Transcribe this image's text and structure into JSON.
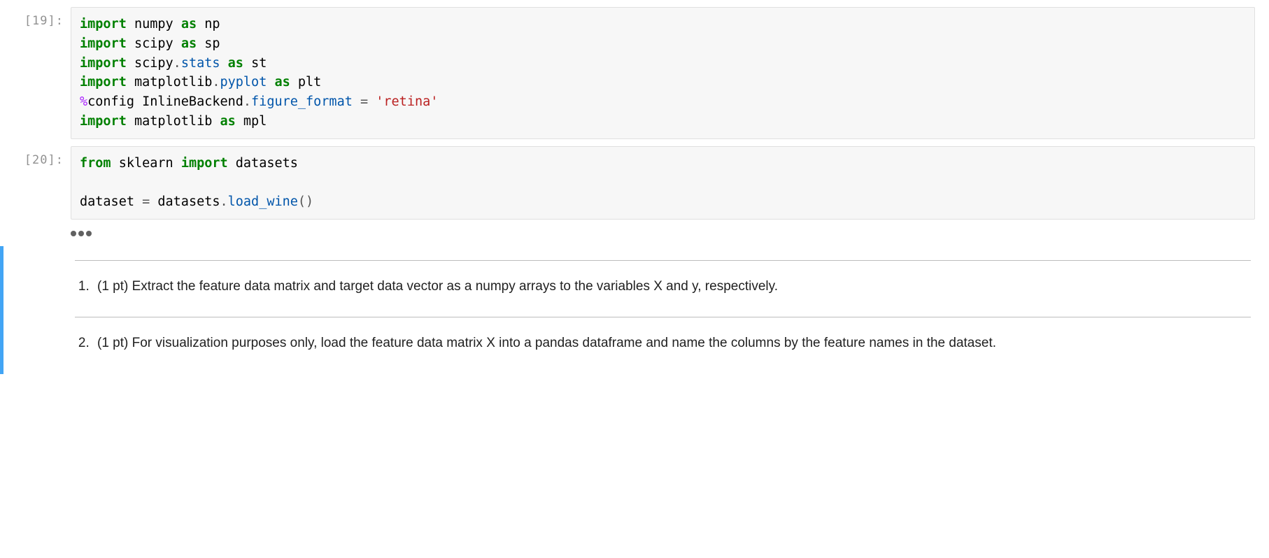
{
  "cells": [
    {
      "prompt": "[19]:",
      "code_tokens": [
        {
          "c": "tok-kw",
          "t": "import"
        },
        {
          "t": " "
        },
        {
          "c": "tok-name",
          "t": "numpy"
        },
        {
          "t": " "
        },
        {
          "c": "tok-kw",
          "t": "as"
        },
        {
          "t": " "
        },
        {
          "c": "tok-name",
          "t": "np"
        },
        {
          "br": true
        },
        {
          "c": "tok-kw",
          "t": "import"
        },
        {
          "t": " "
        },
        {
          "c": "tok-name",
          "t": "scipy"
        },
        {
          "t": " "
        },
        {
          "c": "tok-kw",
          "t": "as"
        },
        {
          "t": " "
        },
        {
          "c": "tok-name",
          "t": "sp"
        },
        {
          "br": true
        },
        {
          "c": "tok-kw",
          "t": "import"
        },
        {
          "t": " "
        },
        {
          "c": "tok-name",
          "t": "scipy"
        },
        {
          "c": "tok-punct",
          "t": "."
        },
        {
          "c": "tok-attr",
          "t": "stats"
        },
        {
          "t": " "
        },
        {
          "c": "tok-kw",
          "t": "as"
        },
        {
          "t": " "
        },
        {
          "c": "tok-name",
          "t": "st"
        },
        {
          "br": true
        },
        {
          "c": "tok-kw",
          "t": "import"
        },
        {
          "t": " "
        },
        {
          "c": "tok-name",
          "t": "matplotlib"
        },
        {
          "c": "tok-punct",
          "t": "."
        },
        {
          "c": "tok-attr",
          "t": "pyplot"
        },
        {
          "t": " "
        },
        {
          "c": "tok-kw",
          "t": "as"
        },
        {
          "t": " "
        },
        {
          "c": "tok-name",
          "t": "plt"
        },
        {
          "br": true
        },
        {
          "c": "tok-op",
          "t": "%"
        },
        {
          "c": "tok-name",
          "t": "config"
        },
        {
          "t": " "
        },
        {
          "c": "tok-name",
          "t": "InlineBackend"
        },
        {
          "c": "tok-punct",
          "t": "."
        },
        {
          "c": "tok-attr",
          "t": "figure_format"
        },
        {
          "t": " "
        },
        {
          "c": "tok-punct",
          "t": "="
        },
        {
          "t": " "
        },
        {
          "c": "tok-str",
          "t": "'retina'"
        },
        {
          "br": true
        },
        {
          "c": "tok-kw",
          "t": "import"
        },
        {
          "t": " "
        },
        {
          "c": "tok-name",
          "t": "matplotlib"
        },
        {
          "t": " "
        },
        {
          "c": "tok-kw",
          "t": "as"
        },
        {
          "t": " "
        },
        {
          "c": "tok-name",
          "t": "mpl"
        }
      ]
    },
    {
      "prompt": "[20]:",
      "code_tokens": [
        {
          "c": "tok-kw",
          "t": "from"
        },
        {
          "t": " "
        },
        {
          "c": "tok-name",
          "t": "sklearn"
        },
        {
          "t": " "
        },
        {
          "c": "tok-kw",
          "t": "import"
        },
        {
          "t": " "
        },
        {
          "c": "tok-name",
          "t": "datasets"
        },
        {
          "br": true
        },
        {
          "br": true
        },
        {
          "c": "tok-name",
          "t": "dataset"
        },
        {
          "t": " "
        },
        {
          "c": "tok-punct",
          "t": "="
        },
        {
          "t": " "
        },
        {
          "c": "tok-name",
          "t": "datasets"
        },
        {
          "c": "tok-punct",
          "t": "."
        },
        {
          "c": "tok-call",
          "t": "load_wine"
        },
        {
          "c": "tok-punct",
          "t": "("
        },
        {
          "c": "tok-punct",
          "t": ")"
        }
      ],
      "collapsed": true
    }
  ],
  "markdown_items": [
    {
      "text": "(1 pt) Extract the feature data matrix and target data vector as a numpy arrays to the variables X and y, respectively."
    },
    {
      "text": "(1 pt) For visualization purposes only, load the feature data matrix X into a pandas dataframe and name the columns by the feature names in the dataset."
    }
  ]
}
